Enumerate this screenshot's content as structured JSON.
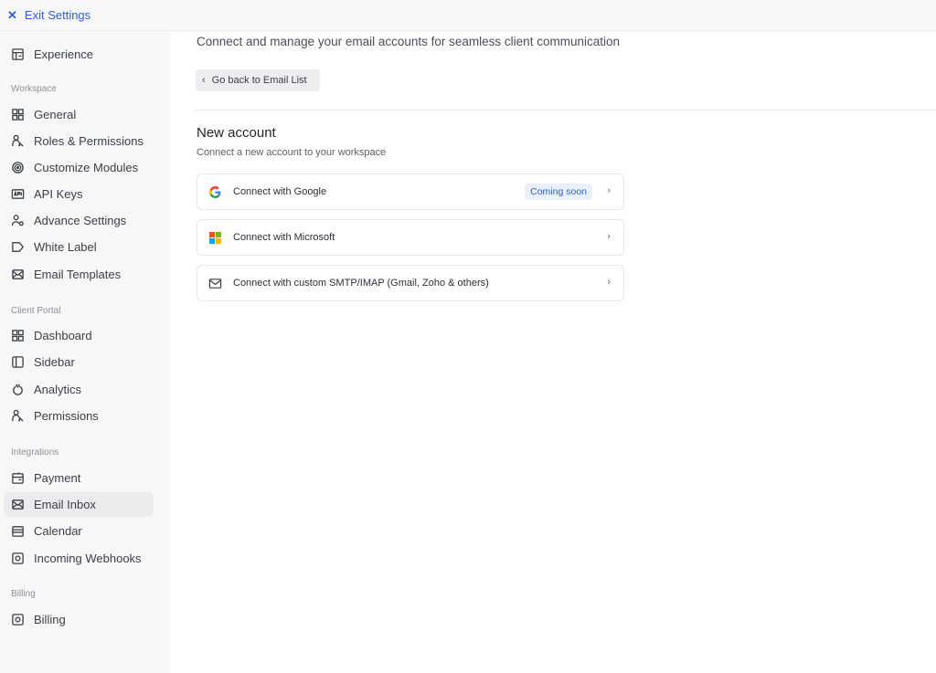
{
  "topbar": {
    "exit_label": "Exit Settings"
  },
  "sidebar": {
    "experience": "Experience",
    "sections": {
      "workspace": "Workspace",
      "client_portal": "Client Portal",
      "integrations": "Integrations",
      "billing": "Billing"
    },
    "workspace_items": [
      {
        "label": "General",
        "icon": "grid-icon"
      },
      {
        "label": "Roles & Permissions",
        "icon": "roles-icon"
      },
      {
        "label": "Customize Modules",
        "icon": "modules-icon"
      },
      {
        "label": "API Keys",
        "icon": "api-icon"
      },
      {
        "label": "Advance Settings",
        "icon": "user-gear-icon"
      },
      {
        "label": "White Label",
        "icon": "tag-icon"
      },
      {
        "label": "Email Templates",
        "icon": "mail-icon"
      }
    ],
    "client_portal_items": [
      {
        "label": "Dashboard",
        "icon": "grid-icon"
      },
      {
        "label": "Sidebar",
        "icon": "sidebar-icon"
      },
      {
        "label": "Analytics",
        "icon": "analytics-icon"
      },
      {
        "label": "Permissions",
        "icon": "roles-icon"
      }
    ],
    "integration_items": [
      {
        "label": "Payment",
        "icon": "payment-icon"
      },
      {
        "label": "Email Inbox",
        "icon": "mail-icon",
        "active": true
      },
      {
        "label": "Calendar",
        "icon": "calendar-icon"
      },
      {
        "label": "Incoming Webhooks",
        "icon": "webhook-icon"
      }
    ],
    "billing_items": [
      {
        "label": "Billing",
        "icon": "billing-icon"
      }
    ]
  },
  "main": {
    "subtitle": "Connect and manage your email accounts for seamless client communication",
    "back_label": "Go back to Email List",
    "section_title": "New account",
    "section_desc": "Connect a new account to your workspace",
    "options": [
      {
        "label": "Connect with Google",
        "icon": "google-icon",
        "badge": "Coming soon"
      },
      {
        "label": "Connect with Microsoft",
        "icon": "microsoft-icon"
      },
      {
        "label": "Connect with custom SMTP/IMAP (Gmail, Zoho & others)",
        "icon": "envelope-icon"
      }
    ]
  },
  "colors": {
    "accent": "#2f5fd0",
    "badge_bg": "#e9f0fb",
    "sidebar_bg": "#f7f7f8"
  }
}
